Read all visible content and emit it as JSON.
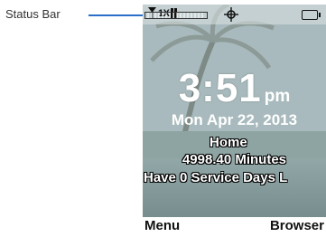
{
  "callout": {
    "label": "Status Bar"
  },
  "status_bar": {
    "indicator_text": "1X",
    "icons": [
      "signal-strength-icon",
      "1x-network-icon",
      "signal-bars-icon",
      "gps-icon",
      "battery-icon"
    ]
  },
  "idle_screen": {
    "time": "3:51",
    "ampm": "pm",
    "date": "Mon Apr 22, 2013",
    "carrier_line": "Home",
    "minutes_line": "4998.40 Minutes",
    "service_line": "Have 0 Service Days L"
  },
  "softkeys": {
    "left": "Menu",
    "right": "Browser"
  },
  "colors": {
    "callout_line": "#2a6fc9",
    "overlay_text": "#ffffff",
    "softkey_text": "#111111"
  }
}
